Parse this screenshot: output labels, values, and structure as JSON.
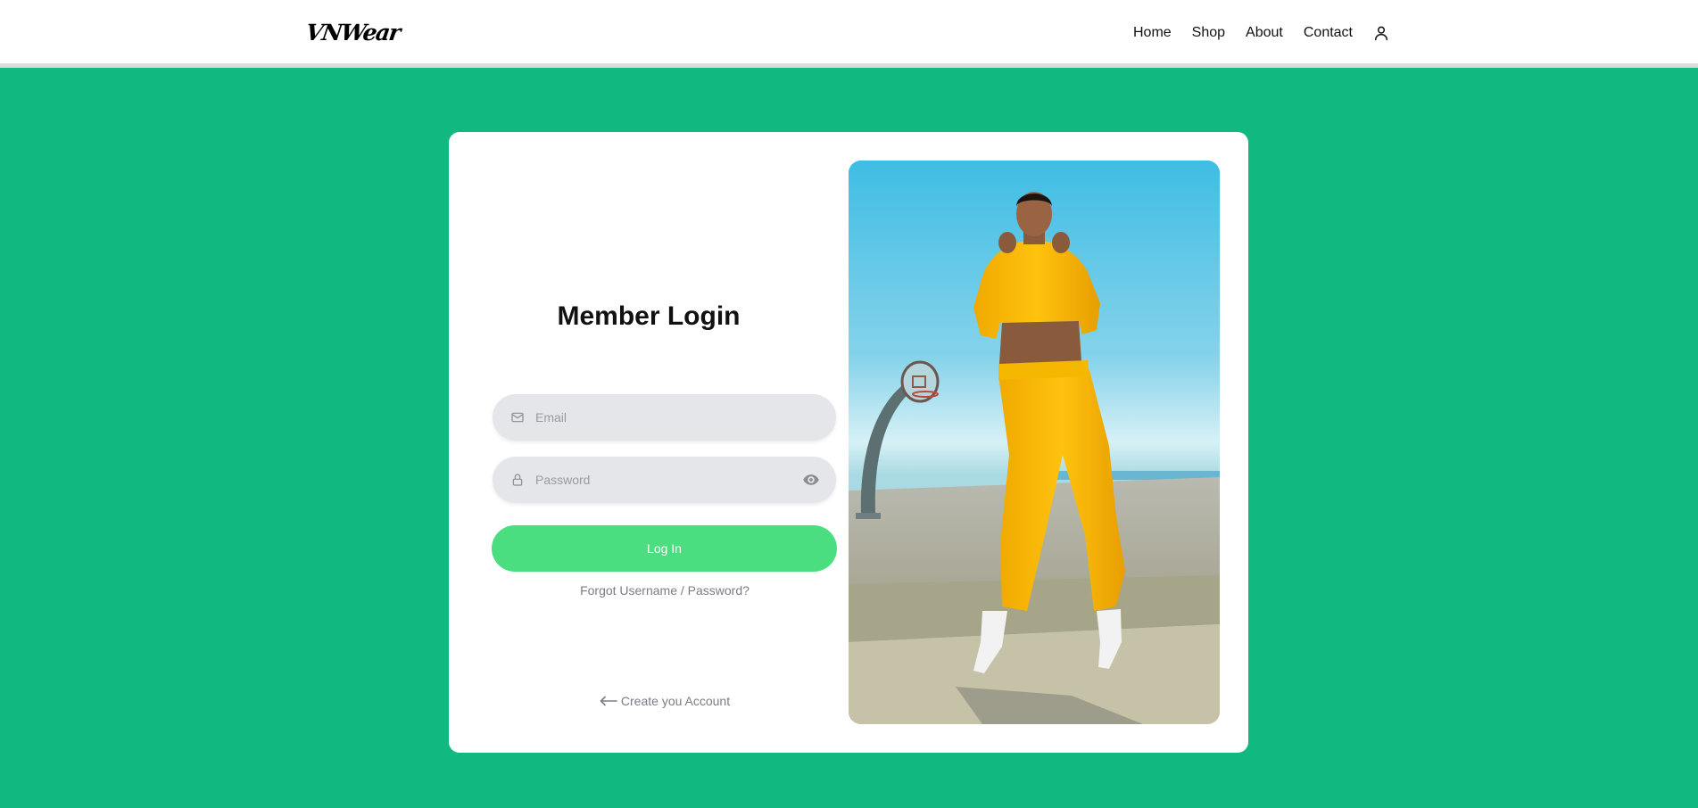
{
  "header": {
    "logo": "VNWear",
    "nav": [
      "Home",
      "Shop",
      "About",
      "Contact"
    ],
    "user_icon": "user-icon"
  },
  "login": {
    "title": "Member Login",
    "email_placeholder": "Email",
    "password_placeholder": "Password",
    "login_button": "Log In",
    "forgot_link": "Forgot Username / Password?",
    "create_account_link": "Create you Account"
  },
  "icons": {
    "email": "mail-icon",
    "password": "lock-icon",
    "toggle_password": "eye-icon",
    "create_account": "arrow-left-icon"
  },
  "colors": {
    "background": "#11b980",
    "button": "#4ade80",
    "input_bg": "#e5e6ea"
  }
}
